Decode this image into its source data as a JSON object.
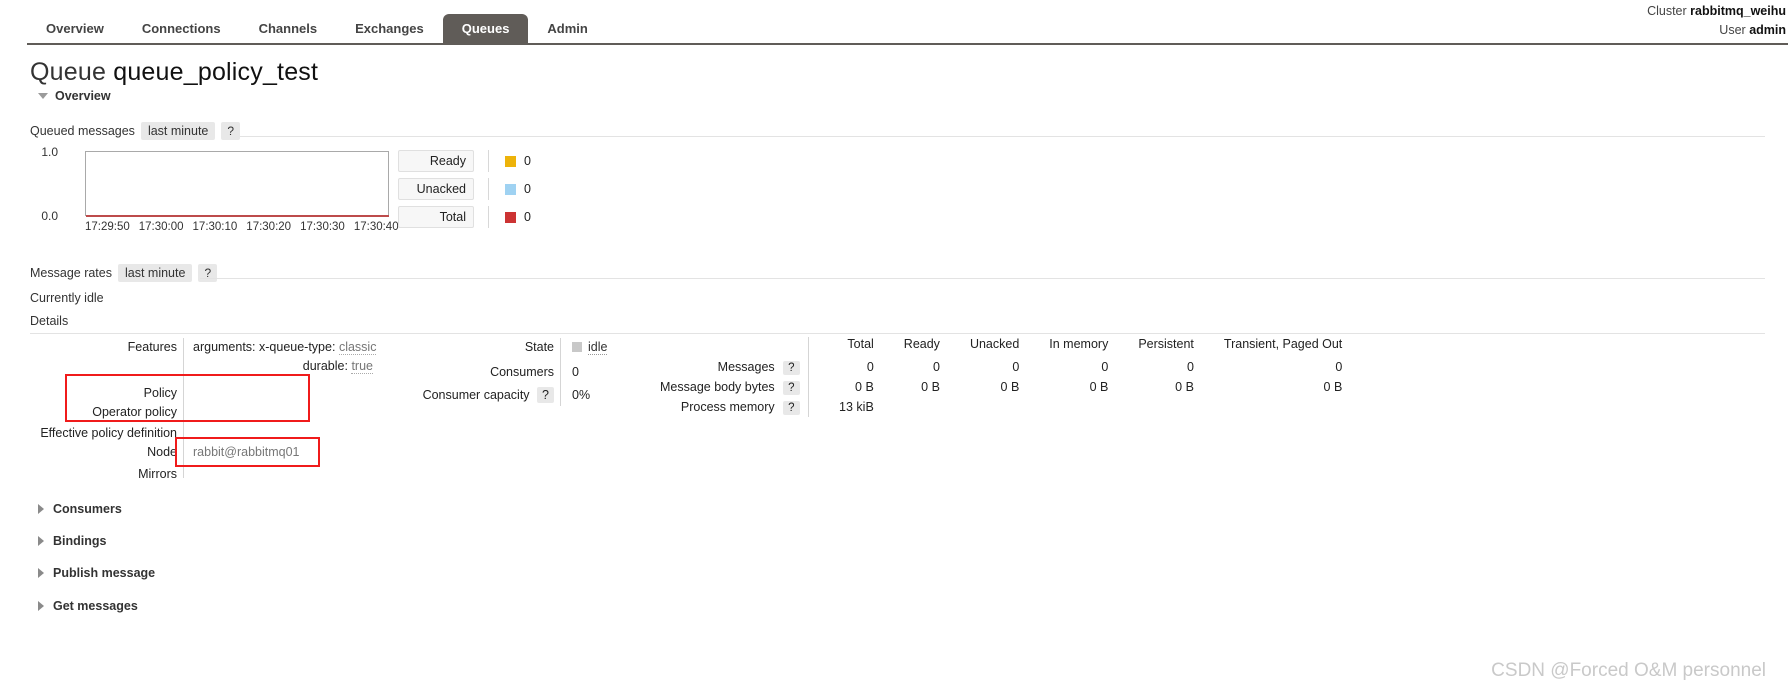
{
  "header": {
    "cluster_label": "Cluster",
    "cluster_name": "rabbitmq_weihu",
    "user_label": "User",
    "user_name": "admin",
    "tabs": [
      {
        "label": "Overview",
        "active": false
      },
      {
        "label": "Connections",
        "active": false
      },
      {
        "label": "Channels",
        "active": false
      },
      {
        "label": "Exchanges",
        "active": false
      },
      {
        "label": "Queues",
        "active": true
      },
      {
        "label": "Admin",
        "active": false
      }
    ]
  },
  "page": {
    "title_prefix": "Queue",
    "queue_name": "queue_policy_test",
    "overview_section": "Overview"
  },
  "queued_messages": {
    "title": "Queued messages",
    "range": "last minute",
    "help": "?"
  },
  "message_rates": {
    "title": "Message rates",
    "range": "last minute",
    "help": "?",
    "status": "Currently idle"
  },
  "details_heading": "Details",
  "chart_data": {
    "type": "line",
    "title": "Queued messages",
    "subtitle": "last minute",
    "x": [
      "17:29:50",
      "17:30:00",
      "17:30:10",
      "17:30:20",
      "17:30:30",
      "17:30:40"
    ],
    "ylim": [
      0.0,
      1.0
    ],
    "ytick_labels": [
      "1.0",
      "0.0"
    ],
    "grid": false,
    "legend_position": "right",
    "series": [
      {
        "name": "Ready",
        "color": "#edb30a",
        "value": "0",
        "values": [
          0,
          0,
          0,
          0,
          0,
          0
        ]
      },
      {
        "name": "Unacked",
        "color": "#9fd2f2",
        "value": "0",
        "values": [
          0,
          0,
          0,
          0,
          0,
          0
        ]
      },
      {
        "name": "Total",
        "color": "#cc3333",
        "value": "0",
        "values": [
          0,
          0,
          0,
          0,
          0,
          0
        ]
      }
    ]
  },
  "details": {
    "features_label": "Features",
    "features": [
      {
        "key": "arguments: x-queue-type:",
        "value": "classic"
      },
      {
        "key": "durable:",
        "value": "true"
      }
    ],
    "policy_label": "Policy",
    "policy_value": "",
    "operator_policy_label": "Operator policy",
    "operator_policy_value": "",
    "effective_policy_label": "Effective policy definition",
    "effective_policy_value": "",
    "node_label": "Node",
    "node_value": "rabbit@rabbitmq01",
    "mirrors_label": "Mirrors",
    "mirrors_value": "",
    "state_label": "State",
    "state_value": "idle",
    "consumers_label": "Consumers",
    "consumers_value": "0",
    "consumer_capacity_label": "Consumer capacity",
    "consumer_capacity_help": "?",
    "consumer_capacity_value": "0%"
  },
  "stats": {
    "columns": [
      "Total",
      "Ready",
      "Unacked",
      "In memory",
      "Persistent",
      "Transient, Paged Out"
    ],
    "rows": [
      {
        "label": "Messages",
        "help": "?",
        "values": [
          "0",
          "0",
          "0",
          "0",
          "0",
          "0"
        ]
      },
      {
        "label": "Message body bytes",
        "help": "?",
        "values": [
          "0 B",
          "0 B",
          "0 B",
          "0 B",
          "0 B",
          "0 B"
        ]
      },
      {
        "label": "Process memory",
        "help": "?",
        "values": [
          "13 kiB",
          "",
          "",
          "",
          "",
          ""
        ]
      }
    ]
  },
  "collapsed_sections": [
    {
      "label": "Consumers"
    },
    {
      "label": "Bindings"
    },
    {
      "label": "Publish message"
    },
    {
      "label": "Get messages"
    }
  ],
  "watermark": "CSDN @Forced O&M personnel",
  "colors": {
    "active_tab_bg": "#605c58",
    "annotation_red": "#f01b1b",
    "ready": "#edb30a",
    "unacked": "#9fd2f2",
    "total": "#cc3333"
  }
}
